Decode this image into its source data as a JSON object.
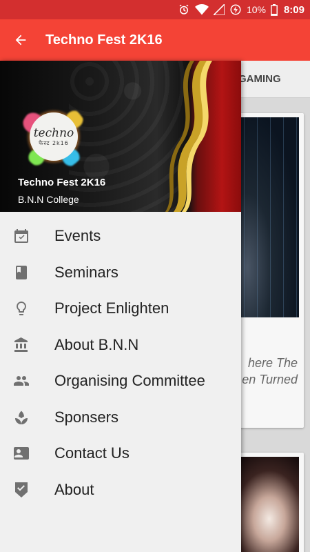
{
  "status_bar": {
    "battery": "10%",
    "time": "8:09"
  },
  "app_bar": {
    "title": "Techno Fest 2K16"
  },
  "background": {
    "tab_label": "GAMING",
    "card_text_line1": "here The",
    "card_text_line2": "en Turned"
  },
  "drawer": {
    "header_title": "Techno Fest 2K16",
    "header_subtitle": "B.N.N College",
    "logo_main": "techno",
    "logo_sub": "फेस्ट 2k16",
    "items": [
      {
        "label": "Events",
        "icon": "event-icon"
      },
      {
        "label": "Seminars",
        "icon": "book-icon"
      },
      {
        "label": "Project Enlighten",
        "icon": "lightbulb-icon"
      },
      {
        "label": "About B.N.N",
        "icon": "institution-icon"
      },
      {
        "label": "Organising Committee",
        "icon": "people-icon"
      },
      {
        "label": "Sponsers",
        "icon": "spa-icon"
      },
      {
        "label": "Contact Us",
        "icon": "contact-card-icon"
      },
      {
        "label": "About",
        "icon": "verified-shield-icon"
      }
    ]
  },
  "colors": {
    "status_bar": "#d32f2f",
    "app_bar": "#f44336",
    "icon": "#707070"
  }
}
